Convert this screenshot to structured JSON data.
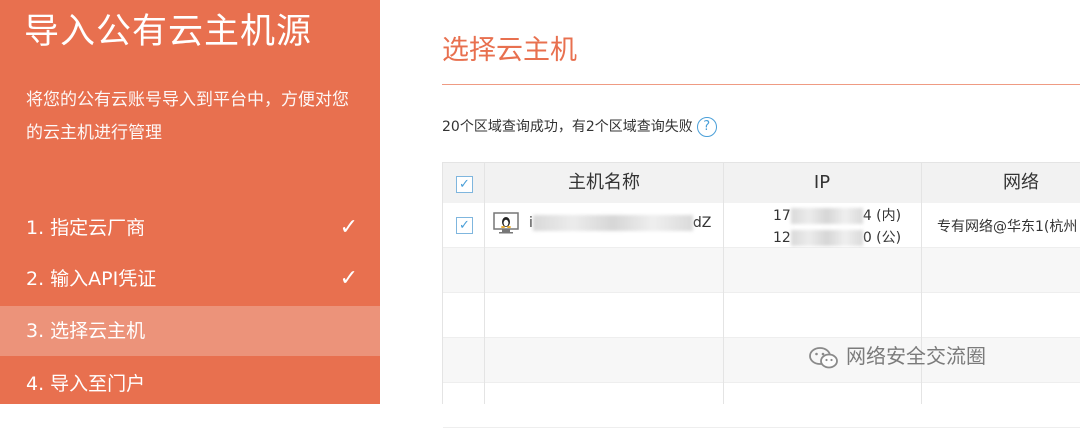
{
  "sidebar": {
    "title": "导入公有云主机源",
    "description": "将您的公有云账号导入到平台中，方便对您的云主机进行管理",
    "steps": [
      {
        "label": "1. 指定云厂商",
        "done_icon": "check-icon"
      },
      {
        "label": "2. 输入API凭证",
        "done_icon": "check-icon"
      },
      {
        "label": "3. 选择云主机"
      },
      {
        "label": "4. 导入至门户"
      }
    ],
    "check_glyph": "✓"
  },
  "main": {
    "title": "选择云主机",
    "query_status": "20个区域查询成功，有2个区域查询失败",
    "help_glyph": "?"
  },
  "table": {
    "headers": [
      "主机名称",
      "IP",
      "网络"
    ],
    "rows": [
      {
        "checked": "✓",
        "os_icon": "linux-icon",
        "host_prefix": "i",
        "host_suffix": "dZ",
        "ip_private_prefix": "17",
        "ip_private_suffix": "4 (内)",
        "ip_public_prefix": "12",
        "ip_public_suffix": "0 (公)",
        "network": "专有网络@华东1(杭州"
      }
    ],
    "header_checked": "✓"
  },
  "watermark": {
    "text": "网络安全交流圈",
    "icon": "wechat-icon"
  },
  "colors": {
    "accent": "#e8704f",
    "active_step": "#ec937a",
    "checkbox_blue": "#4a9fd8"
  }
}
